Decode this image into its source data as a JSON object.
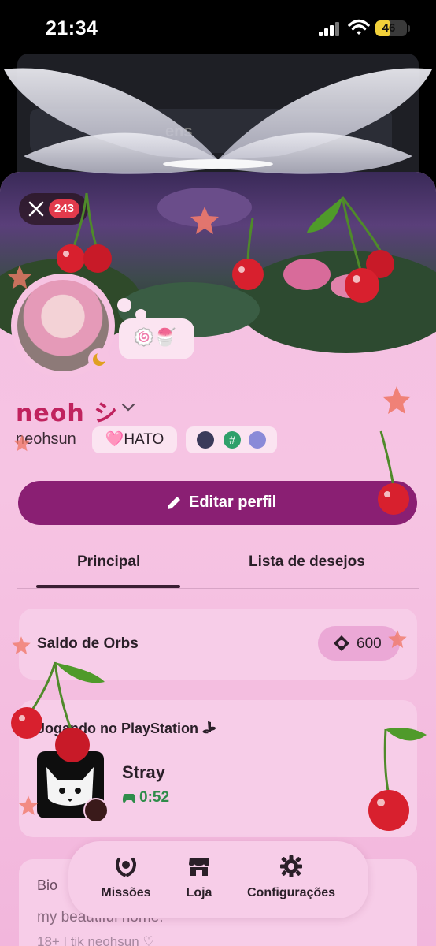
{
  "status_bar": {
    "time": "21:34",
    "battery": "46",
    "battery_level": 0.46
  },
  "background": {
    "peek_text": "ens"
  },
  "profile": {
    "close_badge": "243",
    "display_name": "neoh シ",
    "username": "neohsun",
    "tag": "🩷HATO",
    "status_emojis": "🍥🍧"
  },
  "actions": {
    "edit_profile": "Editar perfil"
  },
  "tabs": [
    {
      "label": "Principal",
      "active": true
    },
    {
      "label": "Lista de desejos",
      "active": false
    }
  ],
  "orbs": {
    "label": "Saldo de Orbs",
    "value": "600"
  },
  "activity": {
    "title": "Jogando no PlayStation",
    "game": "Stray",
    "elapsed": "0:52"
  },
  "bio": {
    "label": "Bio",
    "line1": "my beautiful home.",
    "line2": "18+ | tik neohsun ♡"
  },
  "bottom_nav": [
    {
      "label": "Missões",
      "icon": "laurel-icon"
    },
    {
      "label": "Loja",
      "icon": "shop-icon"
    },
    {
      "label": "Configurações",
      "icon": "gear-icon"
    }
  ],
  "colors": {
    "accent": "#8a1f73",
    "card": "#f6c4e3",
    "name": "#c0235e",
    "time": "#2f8c4a"
  }
}
